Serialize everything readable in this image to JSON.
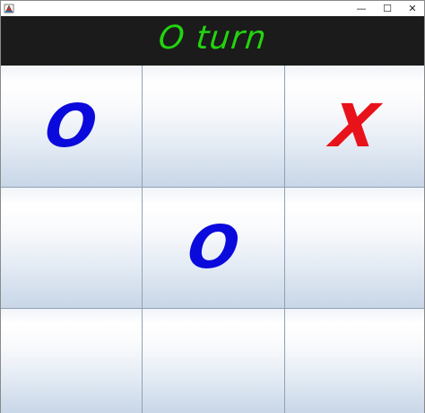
{
  "window": {
    "controls": {
      "minimize": "—",
      "maximize": "☐",
      "close": "✕"
    },
    "icon": "java-app-icon"
  },
  "header": {
    "status": "O turn",
    "status_color": "#22d40e",
    "background": "#1b1b1b"
  },
  "board": {
    "cells": [
      {
        "mark": "O",
        "color": "#0a0adc"
      },
      {
        "mark": "",
        "color": ""
      },
      {
        "mark": "X",
        "color": "#e8121a"
      },
      {
        "mark": "",
        "color": ""
      },
      {
        "mark": "O",
        "color": "#0a0adc"
      },
      {
        "mark": "",
        "color": ""
      },
      {
        "mark": "",
        "color": ""
      },
      {
        "mark": "",
        "color": ""
      },
      {
        "mark": "",
        "color": ""
      }
    ]
  }
}
